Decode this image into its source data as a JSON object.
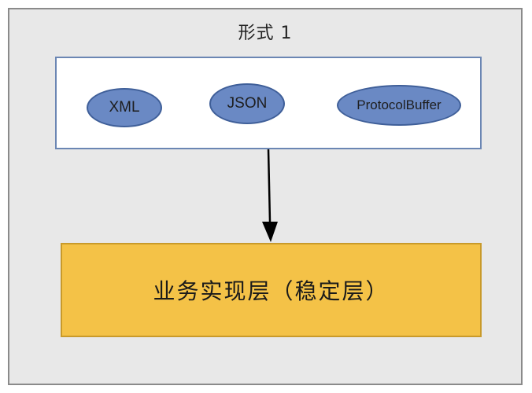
{
  "frame": {
    "title": "形式 1"
  },
  "formats": {
    "items": [
      "XML",
      "JSON",
      "ProtocolBuffer"
    ]
  },
  "business_layer": {
    "label": "业务实现层（稳定层）"
  },
  "colors": {
    "frame_background": "#e8e8e8",
    "frame_border": "#8a8a8a",
    "format_box_border": "#6b86b3",
    "ellipse_fill": "#6a89c4",
    "ellipse_border": "#3f5f99",
    "business_fill": "#f4c247",
    "business_border": "#c99a2a",
    "arrow": "#000000"
  }
}
